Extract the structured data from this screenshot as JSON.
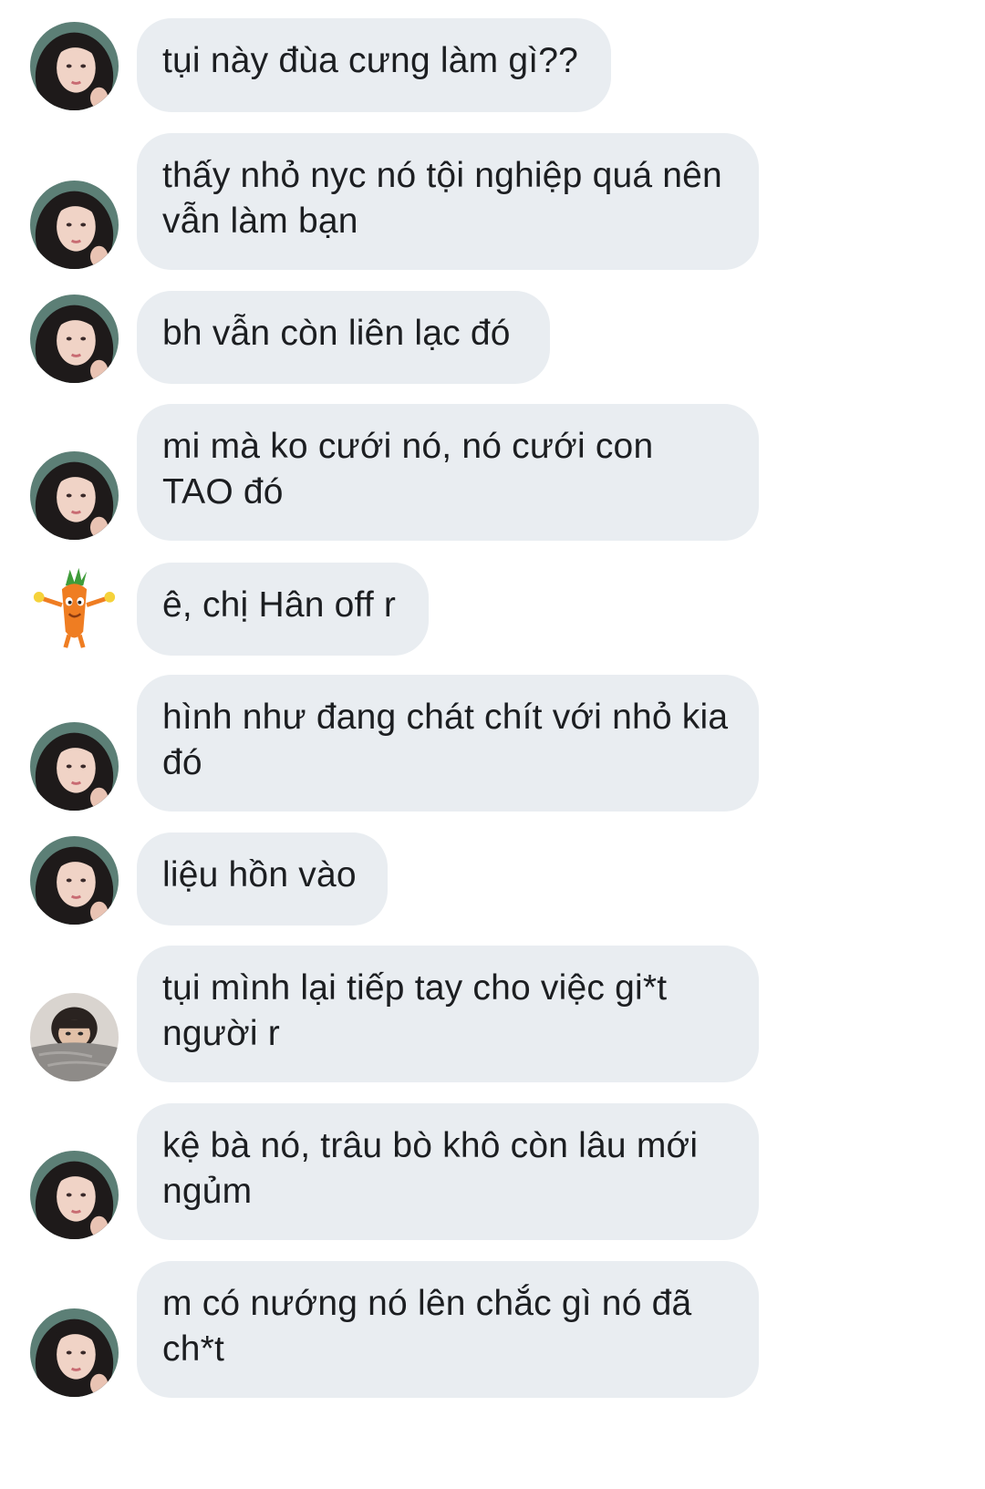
{
  "chat": {
    "messages": [
      {
        "sender": "girl",
        "text": "tụi này đùa cưng làm gì??"
      },
      {
        "sender": "girl",
        "text": "thấy nhỏ nyc nó tội nghiệp quá nên vẫn làm bạn"
      },
      {
        "sender": "girl",
        "text": "bh vẫn còn liên lạc đó"
      },
      {
        "sender": "girl",
        "text": "mi mà ko cưới nó, nó cưới con TAO đó"
      },
      {
        "sender": "carrot",
        "text": "ê, chị Hân off r"
      },
      {
        "sender": "girl",
        "text": "hình như đang chát chít với nhỏ kia đó"
      },
      {
        "sender": "girl",
        "text": "liệu hồn vào"
      },
      {
        "sender": "boy",
        "text": "tụi mình lại tiếp tay cho việc gi*t người r"
      },
      {
        "sender": "girl",
        "text": "kệ bà nó, trâu bò khô còn lâu mới ngủm"
      },
      {
        "sender": "girl",
        "text": "m có nướng nó lên chắc gì nó đã ch*t"
      }
    ]
  },
  "theme": {
    "bubble_color": "#e9edf1",
    "text_color": "#1c1e21",
    "background": "#ffffff"
  }
}
